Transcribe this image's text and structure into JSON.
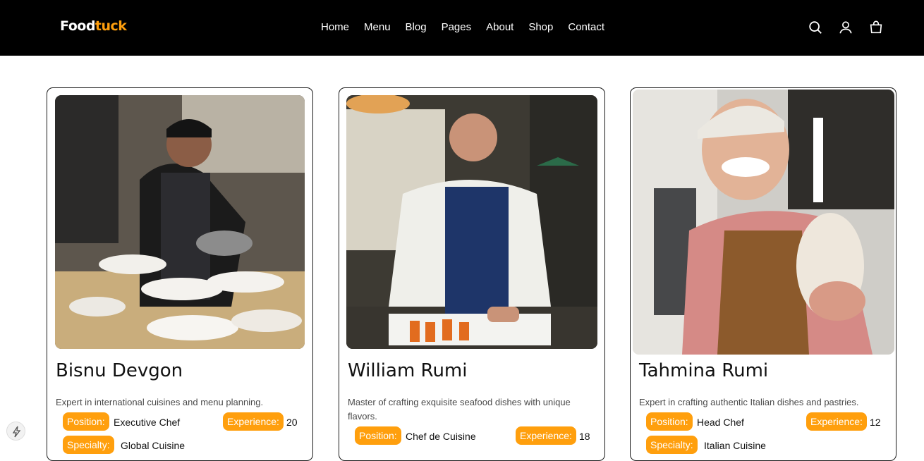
{
  "header": {
    "logo_part1": "Food",
    "logo_part2": "tuck",
    "nav": [
      "Home",
      "Menu",
      "Blog",
      "Pages",
      "About",
      "Shop",
      "Contact"
    ],
    "icons": [
      "search-icon",
      "user-icon",
      "shopping-bag-icon"
    ]
  },
  "chefs": [
    {
      "name": "Bisnu Devgon",
      "description": "Expert in international cuisines and menu planning.",
      "position_label": "Position:",
      "position": "Executive Chef",
      "experience_label": "Experience:",
      "experience": "20",
      "specialty_label": "Specialty:",
      "specialty": "Global Cuisine"
    },
    {
      "name": "William Rumi",
      "description": "Master of crafting exquisite seafood dishes with unique flavors.",
      "position_label": "Position:",
      "position": "Chef de Cuisine",
      "experience_label": "Experience:",
      "experience": "18"
    },
    {
      "name": "Tahmina Rumi",
      "description": "Expert in crafting authentic Italian dishes and pastries.",
      "position_label": "Position:",
      "position": "Head Chef",
      "experience_label": "Experience:",
      "experience": "12",
      "specialty_label": "Specialty:",
      "specialty": "Italian Cuisine"
    }
  ],
  "colors": {
    "accent": "#ff9f0d",
    "header_bg": "#000000"
  }
}
